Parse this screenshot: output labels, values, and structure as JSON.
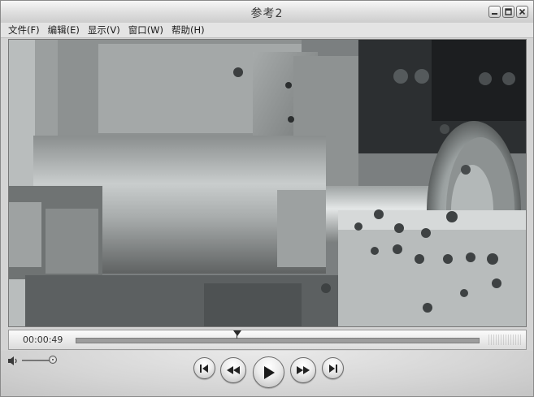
{
  "window": {
    "title": "参考2"
  },
  "menu": [
    {
      "label": "文件",
      "key": "(F)"
    },
    {
      "label": "编辑",
      "key": "(E)"
    },
    {
      "label": "显示",
      "key": "(V)"
    },
    {
      "label": "窗口",
      "key": "(W)"
    },
    {
      "label": "帮助",
      "key": "(H)"
    }
  ],
  "player": {
    "current_time": "00:00:49",
    "progress_fraction": 0.4,
    "volume_fraction": 0.9
  },
  "icons": {
    "minimize": "minimize-icon",
    "maximize": "maximize-icon",
    "close": "close-icon",
    "volume": "speaker-icon",
    "prev": "skip-to-start-icon",
    "rewind": "rewind-icon",
    "play": "play-icon",
    "forward": "fast-forward-icon",
    "next": "skip-to-end-icon"
  }
}
